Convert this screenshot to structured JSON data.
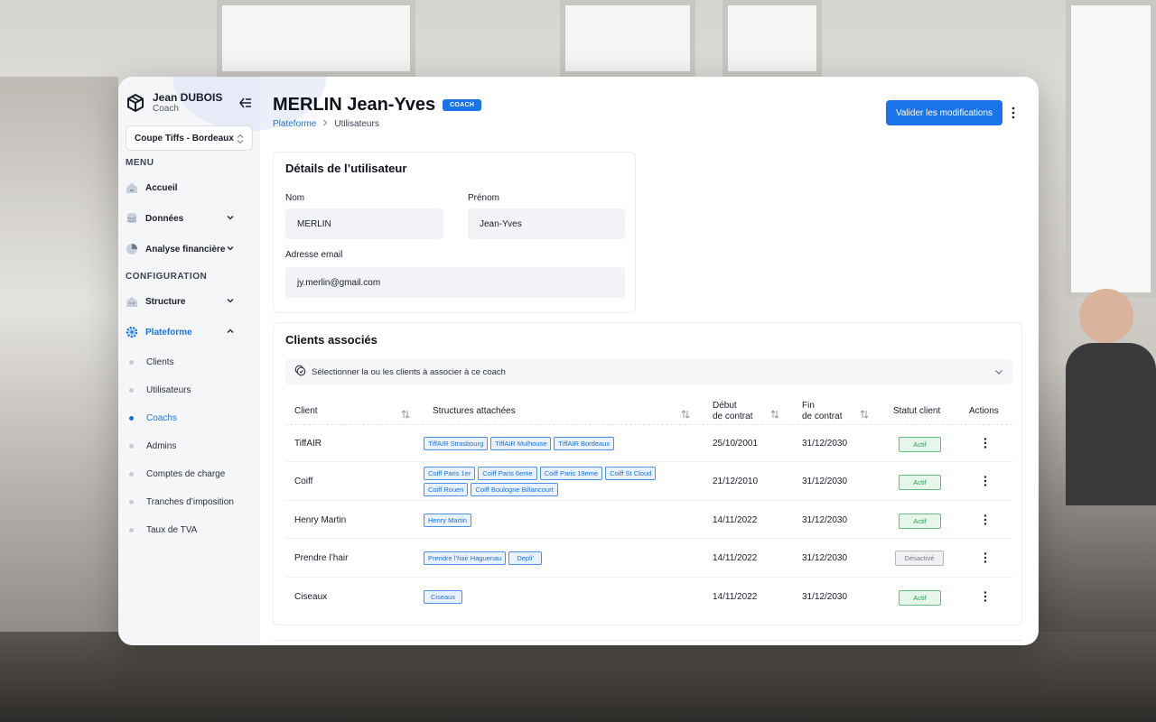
{
  "user": {
    "name": "Jean DUBOIS",
    "role": "Coach"
  },
  "site_select": {
    "value": "Coupe Tiffs - Bordeaux"
  },
  "menu": {
    "section_menu": "MENU",
    "accueil": "Accueil",
    "donnees": "Données",
    "analyse": "Analyse financière",
    "section_config": "CONFIGURATION",
    "structure": "Structure",
    "plateforme": "Plateforme",
    "sub_items": [
      "Clients",
      "Utilisateurs",
      "Coachs",
      "Admins",
      "Comptes de charge",
      "Tranches d’imposition",
      "Taux de TVA"
    ]
  },
  "header": {
    "title": "MERLIN Jean-Yves",
    "badge": "COACH",
    "breadcrumb": [
      "Plateforme",
      "Utilisateurs"
    ],
    "save_button": "Valider les modifications"
  },
  "details": {
    "heading": "Détails de l’utilisateur",
    "nom_label": "Nom",
    "nom_value": "MERLIN",
    "prenom_label": "Prénom",
    "prenom_value": "Jean-Yves",
    "email_label": "Adresse email",
    "email_value": "jy.merlin@gmail.com"
  },
  "clients": {
    "heading": "Clients associés",
    "select_placeholder": "Sélectionner la ou les clients à associer à ce coach",
    "columns": {
      "client": "Client",
      "structures": "Structures attachées",
      "debut_1": "Début",
      "debut_2": "de contrat",
      "fin_1": "Fin",
      "fin_2": "de contrat",
      "statut": "Statut client",
      "actions": "Actions"
    },
    "rows": [
      {
        "client": "TiffAIR",
        "structures": [
          "TiffAIR Strasbourg",
          "TiffAIR Mulhouse",
          "TiffAIR Bordeaux"
        ],
        "debut": "25/10/2001",
        "fin": "31/12/2030",
        "statut": "Actif"
      },
      {
        "client": "Coiff",
        "structures": [
          "Coiff Paris 1er",
          "Coiff Paris 6eme",
          "Coiff Paris 19eme",
          "Coiff St Cloud",
          "Coiff Rouen",
          "Coiff Boulogne Billancourt"
        ],
        "debut": "21/12/2010",
        "fin": "31/12/2030",
        "statut": "Actif"
      },
      {
        "client": "Henry Martin",
        "structures": [
          "Henry Martin"
        ],
        "debut": "14/11/2022",
        "fin": "31/12/2030",
        "statut": "Actif"
      },
      {
        "client": "Prendre l’hair",
        "structures": [
          "Prendre l’hair Haguenau",
          "Depli’"
        ],
        "debut": "14/11/2022",
        "fin": "31/12/2030",
        "statut": "Désactivé"
      },
      {
        "client": "Ciseaux",
        "structures": [
          "Ciseaux"
        ],
        "debut": "14/11/2022",
        "fin": "31/12/2030",
        "statut": "Actif"
      }
    ]
  },
  "colors": {
    "accent": "#1a73e8",
    "active_green": "#2e9e55",
    "inactive_gray": "#7a7d88"
  }
}
